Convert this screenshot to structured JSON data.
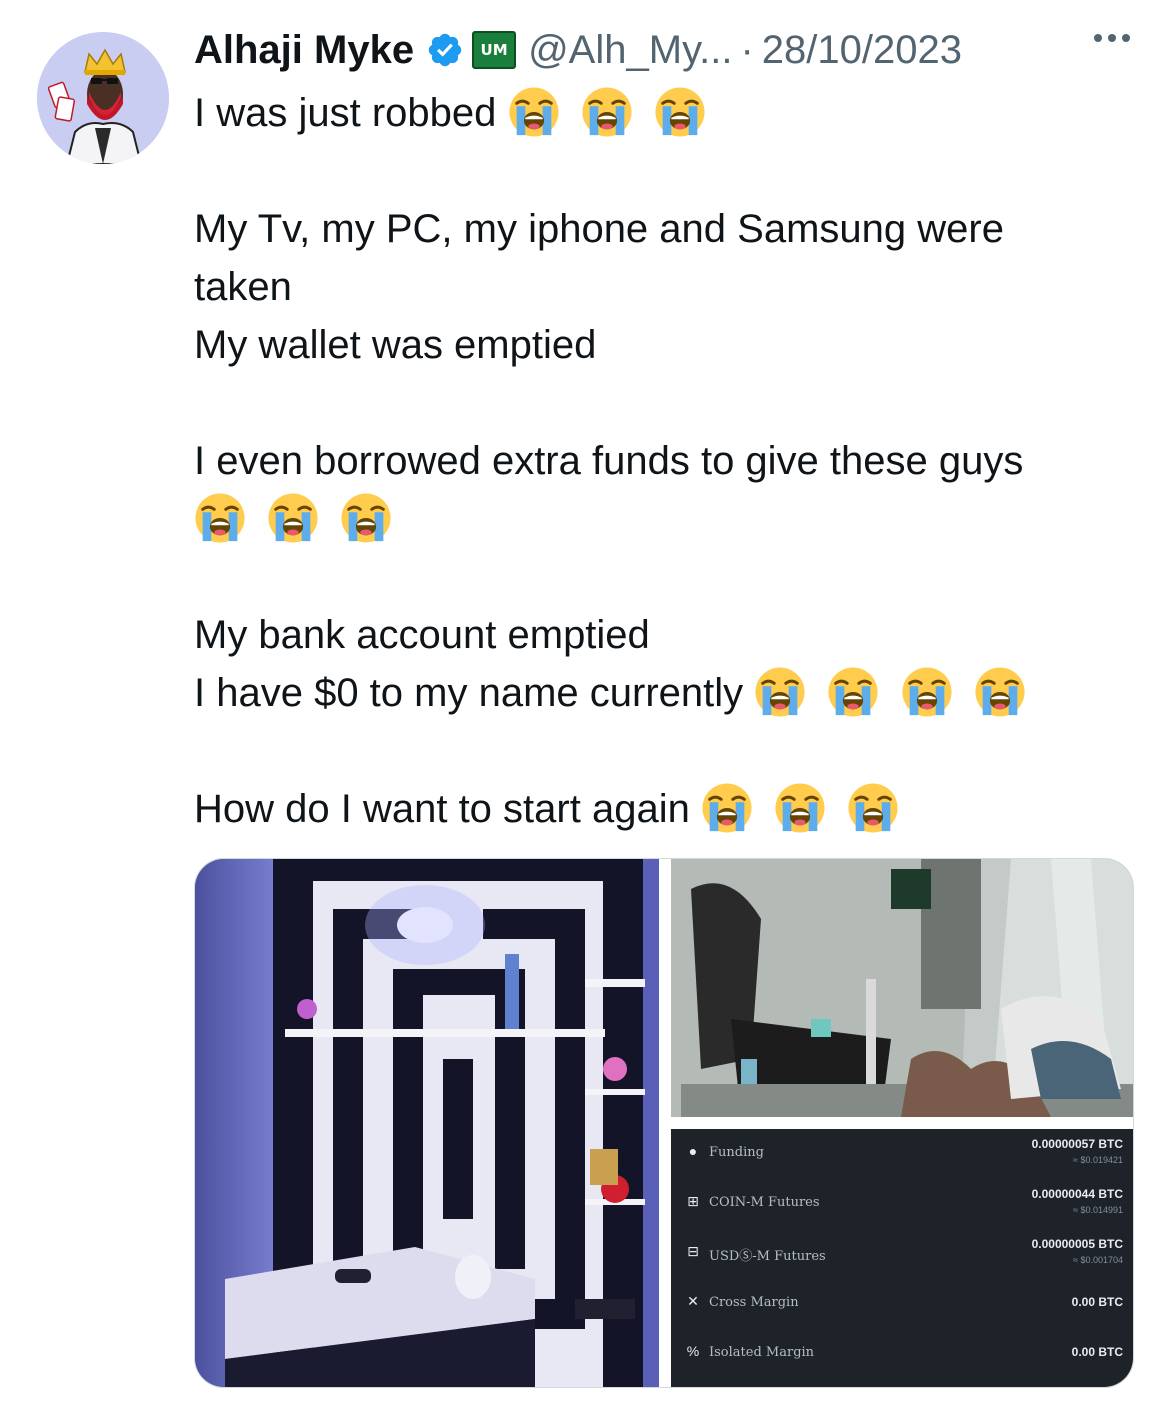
{
  "author": {
    "display_name": "Alhaji Myke",
    "affiliation_badge": "UM",
    "handle": "@Alh_My...",
    "separator": "·",
    "date": "28/10/2023",
    "verified_icon": "verified-badge-icon",
    "more_icon": "more-options-icon"
  },
  "tweet": {
    "line1": "I was just robbed",
    "line2": "My Tv, my PC, my iphone and Samsung were",
    "line3": "taken",
    "line4": "My wallet was emptied",
    "line5": "I even borrowed extra funds to give these guys",
    "line6": "My bank account emptied",
    "line7": "I have $0 to my name currently",
    "line8": "How do I want to start again",
    "emoji_name": "loudly-crying-face-emoji"
  },
  "wallet": {
    "rows": [
      {
        "icon": "funding-icon",
        "label": "Funding",
        "amount": "0.00000057 BTC",
        "usd": "≈ $0.019421"
      },
      {
        "icon": "coin-m-futures-icon",
        "label": "COIN-M Futures",
        "amount": "0.00000044 BTC",
        "usd": "≈ $0.014991"
      },
      {
        "icon": "usds-m-futures-icon",
        "label": "USDⓈ-M Futures",
        "amount": "0.00000005 BTC",
        "usd": "≈ $0.001704"
      },
      {
        "icon": "cross-margin-icon",
        "label": "Cross Margin",
        "amount": "0.00 BTC",
        "usd": ""
      },
      {
        "icon": "isolated-margin-icon",
        "label": "Isolated Margin",
        "amount": "0.00 BTC",
        "usd": ""
      }
    ]
  },
  "colors": {
    "text": "#0f1419",
    "secondary": "#536471",
    "verified": "#1d9bf0",
    "wallet_bg": "#1e2329"
  }
}
